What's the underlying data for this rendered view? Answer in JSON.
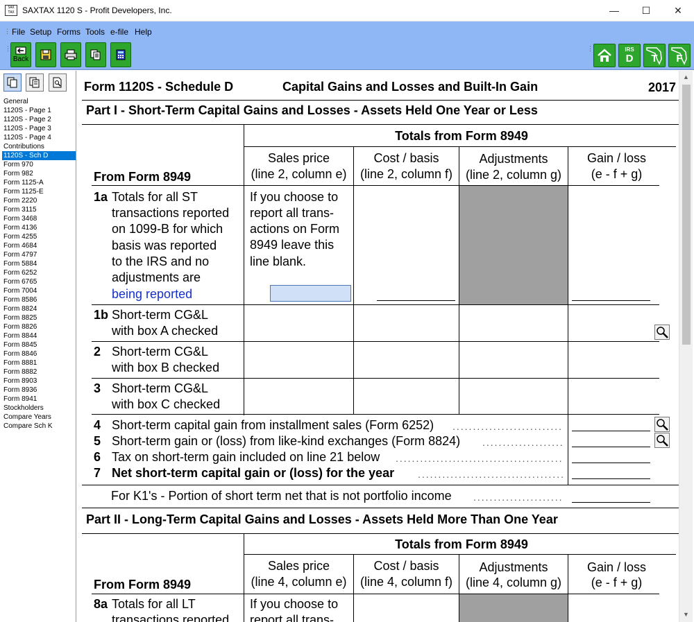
{
  "window": {
    "title": "SAXTAX 1120 S - Profit Developers, Inc.",
    "icon_text": "SAX TAX",
    "controls": {
      "minimize": "—",
      "maximize": "☐",
      "close": "✕"
    }
  },
  "menu": [
    "File",
    "Setup",
    "Forms",
    "Tools",
    "e-file",
    "Help"
  ],
  "toolbar": {
    "back_label": "Back",
    "icons": [
      "back-icon",
      "save-icon",
      "print-icon",
      "copy-icon",
      "calculator-icon"
    ],
    "right_buttons": [
      {
        "name": "home-icon",
        "label": ""
      },
      {
        "name": "irs-d-icon",
        "top": "IRS",
        "label": "D"
      },
      {
        "name": "florida-t-icon",
        "label": "T"
      },
      {
        "name": "florida-f-icon",
        "label": "F"
      }
    ]
  },
  "sidebar": {
    "tools": [
      "pages-icon",
      "copy-pages-icon",
      "preview-icon"
    ],
    "items": [
      "General",
      "1120S - Page 1",
      "1120S - Page 2",
      "1120S - Page 3",
      "1120S - Page 4",
      "Contributions",
      "1120S - Sch D",
      "Form 970",
      "Form 982",
      "Form 1125-A",
      "Form 1125-E",
      "Form 2220",
      "Form 3115",
      "Form 3468",
      "Form 4136",
      "Form 4255",
      "Form 4684",
      "Form 4797",
      "Form 5884",
      "Form 6252",
      "Form 6765",
      "Form 7004",
      "Form 8586",
      "Form 8824",
      "Form 8825",
      "Form 8826",
      "Form 8844",
      "Form 8845",
      "Form 8846",
      "Form 8881",
      "Form 8882",
      "Form 8903",
      "Form 8936",
      "Form 8941",
      "Stockholders",
      "Compare Years",
      "Compare Sch K"
    ],
    "selected_index": 6
  },
  "form": {
    "name": "Form 1120S - Schedule D",
    "title": "Capital Gains and Losses and Built-In Gain",
    "year": "2017",
    "part1": {
      "heading": "Part I - Short-Term Capital Gains and Losses - Assets Held One Year or Less",
      "totals_header": "Totals from Form 8949",
      "from_label": "From Form 8949",
      "columns": [
        {
          "l1": "Sales price",
          "l2": "(line 2, column e)"
        },
        {
          "l1": "Cost / basis",
          "l2": "(line 2, column f)"
        },
        {
          "l1": "Adjustments",
          "l2": "(line 2, column g)"
        },
        {
          "l1": "Gain / loss",
          "l2": "(e - f + g)"
        }
      ],
      "line1a": {
        "num": "1a",
        "text": [
          "Totals for all ST",
          "transactions reported",
          "on 1099-B for which",
          "basis was reported",
          "to the IRS and no",
          "adjustments are"
        ],
        "link": "being reported",
        "note": [
          "If you choose to",
          "report all trans-",
          "actions on Form",
          "8949 leave this",
          "line blank."
        ],
        "input_value": ""
      },
      "line1b": {
        "num": "1b",
        "l1": "Short-term CG&L",
        "l2": "with box A checked"
      },
      "line2": {
        "num": "2",
        "l1": "Short-term CG&L",
        "l2": "with box B checked"
      },
      "line3": {
        "num": "3",
        "l1": "Short-term CG&L",
        "l2": "with box C checked"
      },
      "line4": {
        "num": "4",
        "text": "Short-term capital gain from installment sales (Form 6252)"
      },
      "line5": {
        "num": "5",
        "text": "Short-term gain or (loss) from like-kind exchanges (Form 8824)"
      },
      "line6": {
        "num": "6",
        "text": "Tax on short-term gain included on line 21 below"
      },
      "line7": {
        "num": "7",
        "text": "Net short-term capital gain or (loss) for the year"
      },
      "k1": "For K1's - Portion of short term net that is not portfolio income"
    },
    "part2": {
      "heading": "Part II - Long-Term Capital Gains and Losses - Assets Held More Than One Year",
      "totals_header": "Totals from Form 8949",
      "from_label": "From Form 8949",
      "columns": [
        {
          "l1": "Sales price",
          "l2": "(line 4, column e)"
        },
        {
          "l1": "Cost / basis",
          "l2": "(line 4, column f)"
        },
        {
          "l1": "Adjustments",
          "l2": "(line 4, column g)"
        },
        {
          "l1": "Gain / loss",
          "l2": "(e - f + g)"
        }
      ],
      "line8a": {
        "num": "8a",
        "l1": "Totals for all LT",
        "l2": "transactions reported",
        "note1": "If you choose to",
        "note2": "report all trans-"
      }
    }
  }
}
